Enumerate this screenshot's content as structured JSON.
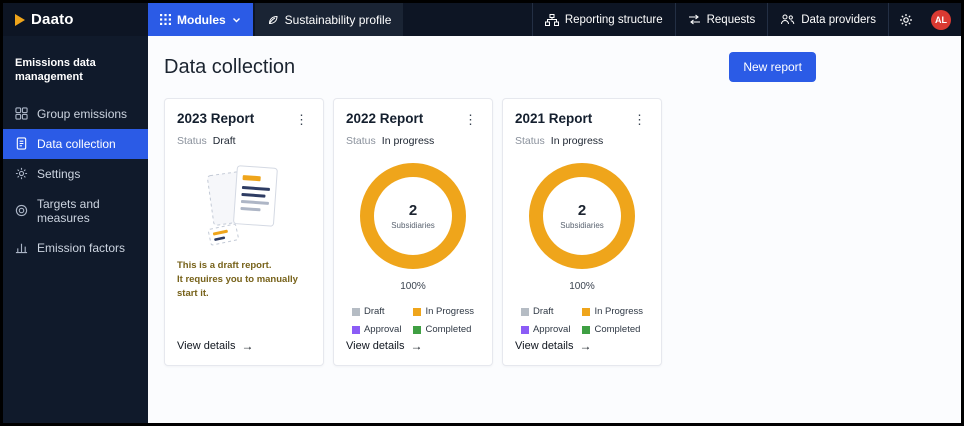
{
  "colors": {
    "accent": "#2b5be6",
    "donut": "#efa51b",
    "avatar": "#da3a32"
  },
  "topbar": {
    "logo_text": "Daato",
    "modules_label": "Modules",
    "sustainability_label": "Sustainability profile",
    "reporting_label": "Reporting structure",
    "requests_label": "Requests",
    "providers_label": "Data providers",
    "avatar_text": "AL"
  },
  "sidebar": {
    "header": "Emissions data management",
    "items": [
      {
        "label": "Group emissions"
      },
      {
        "label": "Data collection"
      },
      {
        "label": "Settings"
      },
      {
        "label": "Targets and measures"
      },
      {
        "label": "Emission factors"
      }
    ]
  },
  "main": {
    "page_title": "Data collection",
    "new_report_label": "New report",
    "cards": [
      {
        "title": "2023 Report",
        "status_label": "Status",
        "status_value": "Draft",
        "note_lines": [
          "This is a draft report.",
          "It requires you to manually start it."
        ],
        "view_details": "View details"
      },
      {
        "title": "2022 Report",
        "status_label": "Status",
        "status_value": "In progress",
        "donut": {
          "center_value": "2",
          "center_label": "Subsidiaries",
          "percent": "100%"
        },
        "legend": [
          {
            "label": "Draft",
            "color": "#b5bcc4"
          },
          {
            "label": "In Progress",
            "color": "#efa51b"
          },
          {
            "label": "Approval",
            "color": "#8b5cf6"
          },
          {
            "label": "Completed",
            "color": "#3f9f43"
          }
        ],
        "view_details": "View details"
      },
      {
        "title": "2021 Report",
        "status_label": "Status",
        "status_value": "In progress",
        "donut": {
          "center_value": "2",
          "center_label": "Subsidiaries",
          "percent": "100%"
        },
        "legend": [
          {
            "label": "Draft",
            "color": "#b5bcc4"
          },
          {
            "label": "In Progress",
            "color": "#efa51b"
          },
          {
            "label": "Approval",
            "color": "#8b5cf6"
          },
          {
            "label": "Completed",
            "color": "#3f9f43"
          }
        ],
        "view_details": "View details"
      }
    ]
  }
}
